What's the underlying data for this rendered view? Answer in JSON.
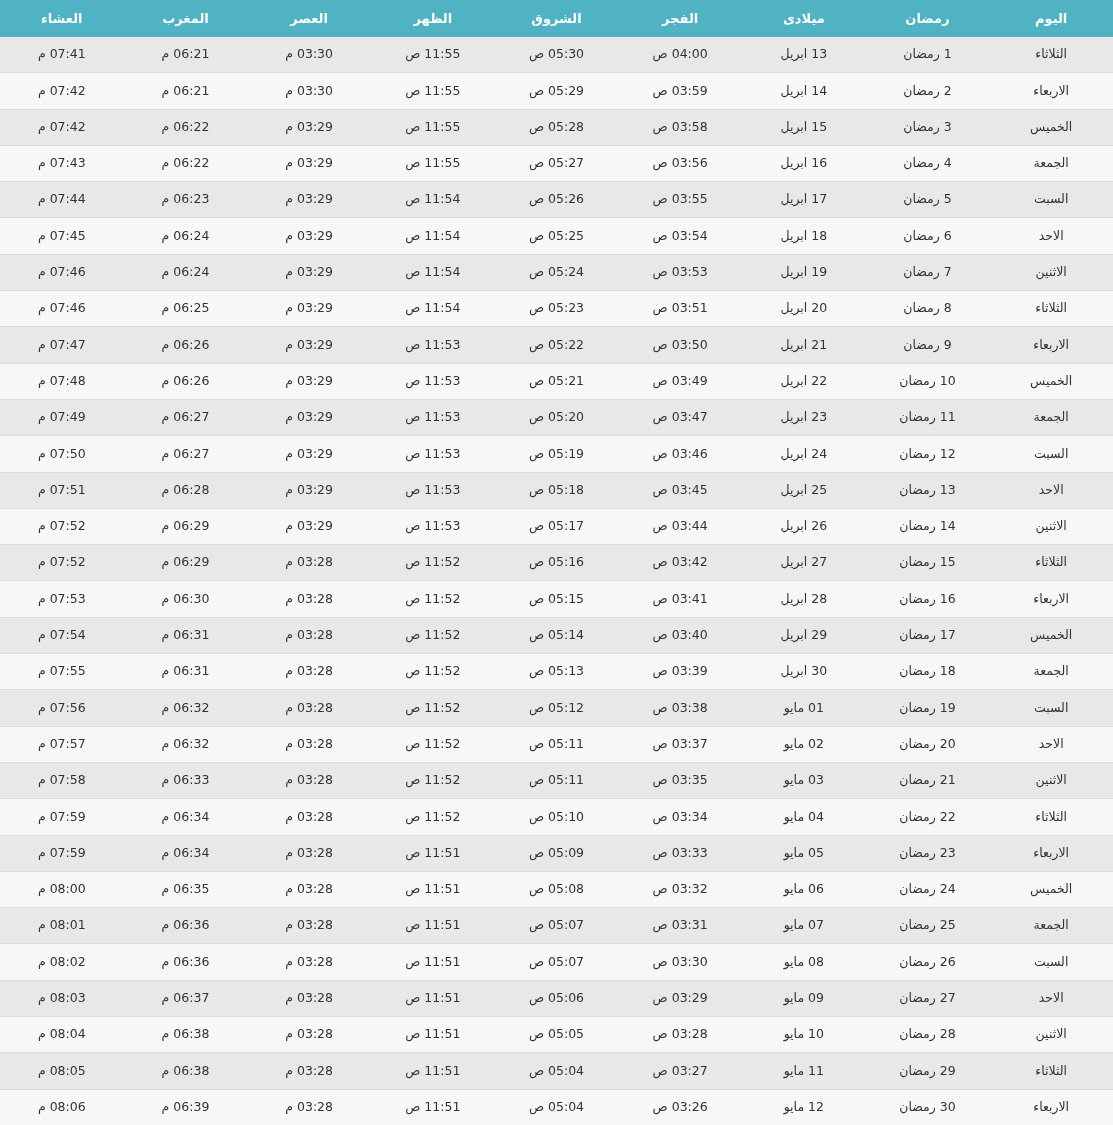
{
  "table": {
    "columns": [
      "اليوم",
      "رمضان",
      "ميلادى",
      "الفجر",
      "الشروق",
      "الظهر",
      "العصر",
      "المغرب",
      "العشاء"
    ],
    "rows": [
      [
        "الثلاثاء",
        "1 رمضان",
        "13 ابريل",
        "04:00 ص",
        "05:30 ص",
        "11:55 ص",
        "03:30 م",
        "06:21 م",
        "07:41 م"
      ],
      [
        "الاربعاء",
        "2 رمضان",
        "14 ابريل",
        "03:59 ص",
        "05:29 ص",
        "11:55 ص",
        "03:30 م",
        "06:21 م",
        "07:42 م"
      ],
      [
        "الخميس",
        "3 رمضان",
        "15 ابريل",
        "03:58 ص",
        "05:28 ص",
        "11:55 ص",
        "03:29 م",
        "06:22 م",
        "07:42 م"
      ],
      [
        "الجمعة",
        "4 رمضان",
        "16 ابريل",
        "03:56 ص",
        "05:27 ص",
        "11:55 ص",
        "03:29 م",
        "06:22 م",
        "07:43 م"
      ],
      [
        "السبت",
        "5 رمضان",
        "17 ابريل",
        "03:55 ص",
        "05:26 ص",
        "11:54 ص",
        "03:29 م",
        "06:23 م",
        "07:44 م"
      ],
      [
        "الاحد",
        "6 رمضان",
        "18 ابريل",
        "03:54 ص",
        "05:25 ص",
        "11:54 ص",
        "03:29 م",
        "06:24 م",
        "07:45 م"
      ],
      [
        "الاثنين",
        "7 رمضان",
        "19 ابريل",
        "03:53 ص",
        "05:24 ص",
        "11:54 ص",
        "03:29 م",
        "06:24 م",
        "07:46 م"
      ],
      [
        "الثلاثاء",
        "8 رمضان",
        "20 ابريل",
        "03:51 ص",
        "05:23 ص",
        "11:54 ص",
        "03:29 م",
        "06:25 م",
        "07:46 م"
      ],
      [
        "الاربعاء",
        "9 رمضان",
        "21 ابريل",
        "03:50 ص",
        "05:22 ص",
        "11:53 ص",
        "03:29 م",
        "06:26 م",
        "07:47 م"
      ],
      [
        "الخميس",
        "10 رمضان",
        "22 ابريل",
        "03:49 ص",
        "05:21 ص",
        "11:53 ص",
        "03:29 م",
        "06:26 م",
        "07:48 م"
      ],
      [
        "الجمعة",
        "11 رمضان",
        "23 ابريل",
        "03:47 ص",
        "05:20 ص",
        "11:53 ص",
        "03:29 م",
        "06:27 م",
        "07:49 م"
      ],
      [
        "السبت",
        "12 رمضان",
        "24 ابريل",
        "03:46 ص",
        "05:19 ص",
        "11:53 ص",
        "03:29 م",
        "06:27 م",
        "07:50 م"
      ],
      [
        "الاحد",
        "13 رمضان",
        "25 ابريل",
        "03:45 ص",
        "05:18 ص",
        "11:53 ص",
        "03:29 م",
        "06:28 م",
        "07:51 م"
      ],
      [
        "الاثنين",
        "14 رمضان",
        "26 ابريل",
        "03:44 ص",
        "05:17 ص",
        "11:53 ص",
        "03:29 م",
        "06:29 م",
        "07:52 م"
      ],
      [
        "الثلاثاء",
        "15 رمضان",
        "27 ابريل",
        "03:42 ص",
        "05:16 ص",
        "11:52 ص",
        "03:28 م",
        "06:29 م",
        "07:52 م"
      ],
      [
        "الاربعاء",
        "16 رمضان",
        "28 ابريل",
        "03:41 ص",
        "05:15 ص",
        "11:52 ص",
        "03:28 م",
        "06:30 م",
        "07:53 م"
      ],
      [
        "الخميس",
        "17 رمضان",
        "29 ابريل",
        "03:40 ص",
        "05:14 ص",
        "11:52 ص",
        "03:28 م",
        "06:31 م",
        "07:54 م"
      ],
      [
        "الجمعة",
        "18 رمضان",
        "30 ابريل",
        "03:39 ص",
        "05:13 ص",
        "11:52 ص",
        "03:28 م",
        "06:31 م",
        "07:55 م"
      ],
      [
        "السبت",
        "19 رمضان",
        "01 مايو",
        "03:38 ص",
        "05:12 ص",
        "11:52 ص",
        "03:28 م",
        "06:32 م",
        "07:56 م"
      ],
      [
        "الاحد",
        "20 رمضان",
        "02 مايو",
        "03:37 ص",
        "05:11 ص",
        "11:52 ص",
        "03:28 م",
        "06:32 م",
        "07:57 م"
      ],
      [
        "الاثنين",
        "21 رمضان",
        "03 مايو",
        "03:35 ص",
        "05:11 ص",
        "11:52 ص",
        "03:28 م",
        "06:33 م",
        "07:58 م"
      ],
      [
        "الثلاثاء",
        "22 رمضان",
        "04 مايو",
        "03:34 ص",
        "05:10 ص",
        "11:52 ص",
        "03:28 م",
        "06:34 م",
        "07:59 م"
      ],
      [
        "الاربعاء",
        "23 رمضان",
        "05 مايو",
        "03:33 ص",
        "05:09 ص",
        "11:51 ص",
        "03:28 م",
        "06:34 م",
        "07:59 م"
      ],
      [
        "الخميس",
        "24 رمضان",
        "06 مايو",
        "03:32 ص",
        "05:08 ص",
        "11:51 ص",
        "03:28 م",
        "06:35 م",
        "08:00 م"
      ],
      [
        "الجمعة",
        "25 رمضان",
        "07 مايو",
        "03:31 ص",
        "05:07 ص",
        "11:51 ص",
        "03:28 م",
        "06:36 م",
        "08:01 م"
      ],
      [
        "السبت",
        "26 رمضان",
        "08 مايو",
        "03:30 ص",
        "05:07 ص",
        "11:51 ص",
        "03:28 م",
        "06:36 م",
        "08:02 م"
      ],
      [
        "الاحد",
        "27 رمضان",
        "09 مايو",
        "03:29 ص",
        "05:06 ص",
        "11:51 ص",
        "03:28 م",
        "06:37 م",
        "08:03 م"
      ],
      [
        "الاثنين",
        "28 رمضان",
        "10 مايو",
        "03:28 ص",
        "05:05 ص",
        "11:51 ص",
        "03:28 م",
        "06:38 م",
        "08:04 م"
      ],
      [
        "الثلاثاء",
        "29 رمضان",
        "11 مايو",
        "03:27 ص",
        "05:04 ص",
        "11:51 ص",
        "03:28 م",
        "06:38 م",
        "08:05 م"
      ],
      [
        "الاربعاء",
        "30 رمضان",
        "12 مايو",
        "03:26 ص",
        "05:04 ص",
        "11:51 ص",
        "03:28 م",
        "06:39 م",
        "08:06 م"
      ]
    ]
  }
}
